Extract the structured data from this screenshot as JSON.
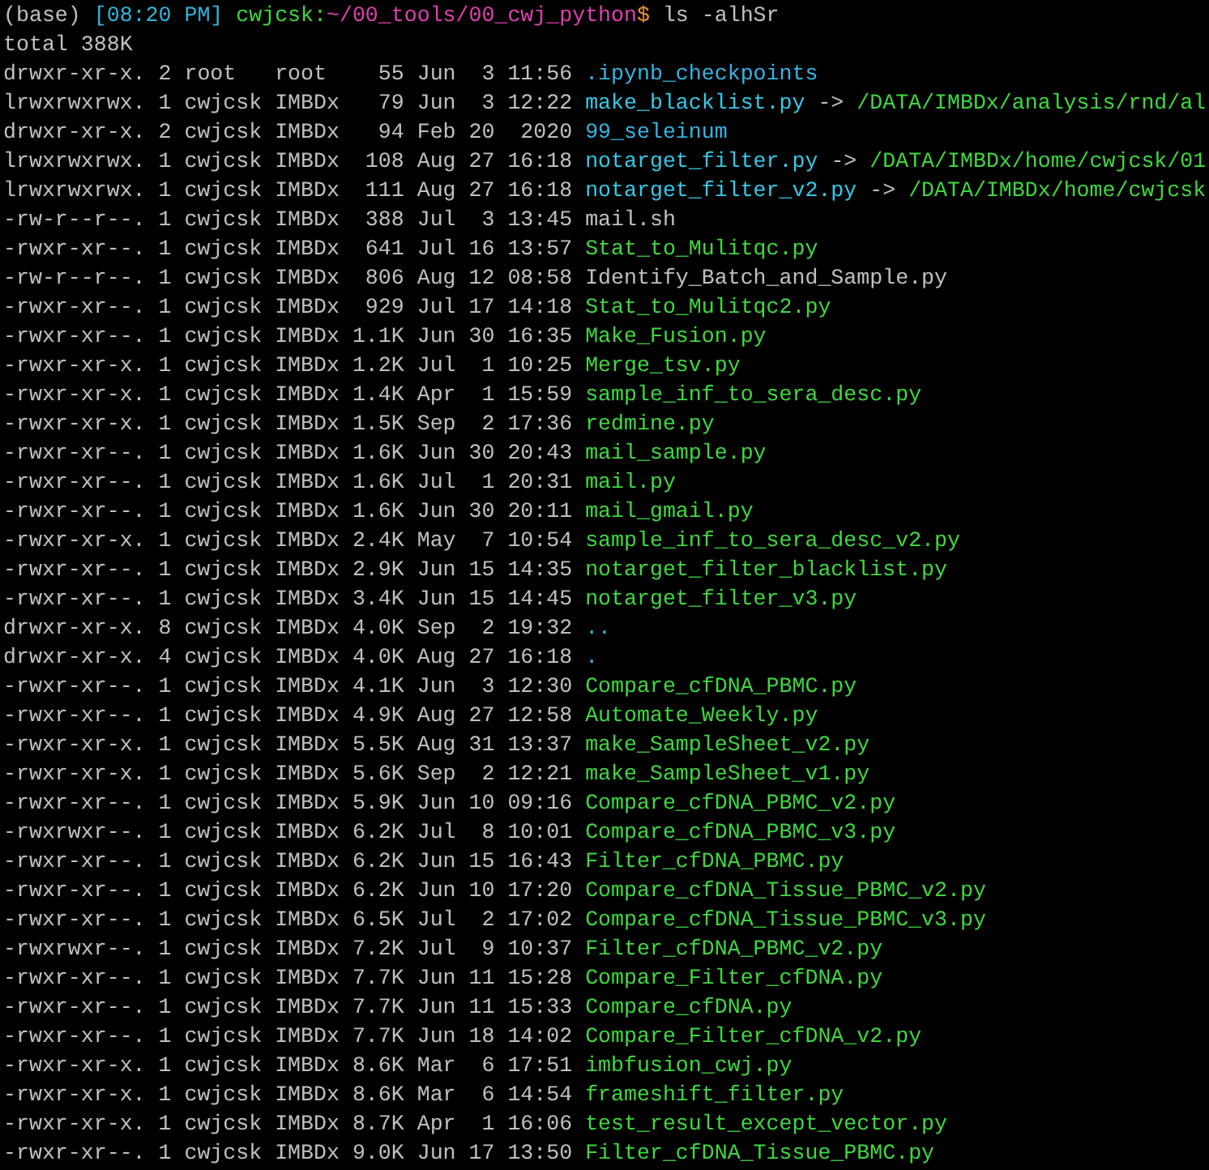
{
  "prompt": {
    "env": "(base)",
    "time": "[08:20 PM]",
    "userhost": "cwjcsk:",
    "path": "~/00_tools/00_cwj_python",
    "symbol": "$",
    "command": "ls -alhSr"
  },
  "total": "total 388K",
  "rows": [
    {
      "meta": "drwxr-xr-x. 2 root   root    55 Jun  3 11:56",
      "name": ".ipynb_checkpoints",
      "kind": "dir"
    },
    {
      "meta": "lrwxrwxrwx. 1 cwjcsk IMBDx   79 Jun  3 12:22",
      "name": "make_blacklist.py",
      "kind": "link",
      "arrow": "->",
      "target": "/DATA/IMBDx/analysis/rnd/al"
    },
    {
      "meta": "drwxr-xr-x. 2 cwjcsk IMBDx   94 Feb 20  2020",
      "name": "99_seleinum",
      "kind": "dir"
    },
    {
      "meta": "lrwxrwxrwx. 1 cwjcsk IMBDx  108 Aug 27 16:18",
      "name": "notarget_filter.py",
      "kind": "link",
      "arrow": "->",
      "target": "/DATA/IMBDx/home/cwjcsk/01"
    },
    {
      "meta": "lrwxrwxrwx. 1 cwjcsk IMBDx  111 Aug 27 16:18",
      "name": "notarget_filter_v2.py",
      "kind": "link",
      "arrow": "->",
      "target": "/DATA/IMBDx/home/cwjcsk"
    },
    {
      "meta": "-rw-r--r--. 1 cwjcsk IMBDx  388 Jul  3 13:45",
      "name": "mail.sh",
      "kind": "file"
    },
    {
      "meta": "-rwxr-xr--. 1 cwjcsk IMBDx  641 Jul 16 13:57",
      "name": "Stat_to_Mulitqc.py",
      "kind": "exec"
    },
    {
      "meta": "-rw-r--r--. 1 cwjcsk IMBDx  806 Aug 12 08:58",
      "name": "Identify_Batch_and_Sample.py",
      "kind": "file"
    },
    {
      "meta": "-rwxr-xr--. 1 cwjcsk IMBDx  929 Jul 17 14:18",
      "name": "Stat_to_Mulitqc2.py",
      "kind": "exec"
    },
    {
      "meta": "-rwxr-xr--. 1 cwjcsk IMBDx 1.1K Jun 30 16:35",
      "name": "Make_Fusion.py",
      "kind": "exec"
    },
    {
      "meta": "-rwxr-xr-x. 1 cwjcsk IMBDx 1.2K Jul  1 10:25",
      "name": "Merge_tsv.py",
      "kind": "exec"
    },
    {
      "meta": "-rwxr-xr-x. 1 cwjcsk IMBDx 1.4K Apr  1 15:59",
      "name": "sample_inf_to_sera_desc.py",
      "kind": "exec"
    },
    {
      "meta": "-rwxr-xr-x. 1 cwjcsk IMBDx 1.5K Sep  2 17:36",
      "name": "redmine.py",
      "kind": "exec"
    },
    {
      "meta": "-rwxr-xr--. 1 cwjcsk IMBDx 1.6K Jun 30 20:43",
      "name": "mail_sample.py",
      "kind": "exec"
    },
    {
      "meta": "-rwxr-xr--. 1 cwjcsk IMBDx 1.6K Jul  1 20:31",
      "name": "mail.py",
      "kind": "exec"
    },
    {
      "meta": "-rwxr-xr--. 1 cwjcsk IMBDx 1.6K Jun 30 20:11",
      "name": "mail_gmail.py",
      "kind": "exec"
    },
    {
      "meta": "-rwxr-xr-x. 1 cwjcsk IMBDx 2.4K May  7 10:54",
      "name": "sample_inf_to_sera_desc_v2.py",
      "kind": "exec"
    },
    {
      "meta": "-rwxr-xr--. 1 cwjcsk IMBDx 2.9K Jun 15 14:35",
      "name": "notarget_filter_blacklist.py",
      "kind": "exec"
    },
    {
      "meta": "-rwxr-xr--. 1 cwjcsk IMBDx 3.4K Jun 15 14:45",
      "name": "notarget_filter_v3.py",
      "kind": "exec"
    },
    {
      "meta": "drwxr-xr-x. 8 cwjcsk IMBDx 4.0K Sep  2 19:32",
      "name": "..",
      "kind": "dir"
    },
    {
      "meta": "drwxr-xr-x. 4 cwjcsk IMBDx 4.0K Aug 27 16:18",
      "name": ".",
      "kind": "dir"
    },
    {
      "meta": "-rwxr-xr--. 1 cwjcsk IMBDx 4.1K Jun  3 12:30",
      "name": "Compare_cfDNA_PBMC.py",
      "kind": "exec"
    },
    {
      "meta": "-rwxr-xr--. 1 cwjcsk IMBDx 4.9K Aug 27 12:58",
      "name": "Automate_Weekly.py",
      "kind": "exec"
    },
    {
      "meta": "-rwxr-xr-x. 1 cwjcsk IMBDx 5.5K Aug 31 13:37",
      "name": "make_SampleSheet_v2.py",
      "kind": "exec"
    },
    {
      "meta": "-rwxr-xr-x. 1 cwjcsk IMBDx 5.6K Sep  2 12:21",
      "name": "make_SampleSheet_v1.py",
      "kind": "exec"
    },
    {
      "meta": "-rwxr-xr--. 1 cwjcsk IMBDx 5.9K Jun 10 09:16",
      "name": "Compare_cfDNA_PBMC_v2.py",
      "kind": "exec"
    },
    {
      "meta": "-rwxrwxr--. 1 cwjcsk IMBDx 6.2K Jul  8 10:01",
      "name": "Compare_cfDNA_PBMC_v3.py",
      "kind": "exec"
    },
    {
      "meta": "-rwxr-xr--. 1 cwjcsk IMBDx 6.2K Jun 15 16:43",
      "name": "Filter_cfDNA_PBMC.py",
      "kind": "exec"
    },
    {
      "meta": "-rwxr-xr--. 1 cwjcsk IMBDx 6.2K Jun 10 17:20",
      "name": "Compare_cfDNA_Tissue_PBMC_v2.py",
      "kind": "exec"
    },
    {
      "meta": "-rwxr-xr--. 1 cwjcsk IMBDx 6.5K Jul  2 17:02",
      "name": "Compare_cfDNA_Tissue_PBMC_v3.py",
      "kind": "exec"
    },
    {
      "meta": "-rwxrwxr--. 1 cwjcsk IMBDx 7.2K Jul  9 10:37",
      "name": "Filter_cfDNA_PBMC_v2.py",
      "kind": "exec"
    },
    {
      "meta": "-rwxr-xr--. 1 cwjcsk IMBDx 7.7K Jun 11 15:28",
      "name": "Compare_Filter_cfDNA.py",
      "kind": "exec"
    },
    {
      "meta": "-rwxr-xr--. 1 cwjcsk IMBDx 7.7K Jun 11 15:33",
      "name": "Compare_cfDNA.py",
      "kind": "exec"
    },
    {
      "meta": "-rwxr-xr--. 1 cwjcsk IMBDx 7.7K Jun 18 14:02",
      "name": "Compare_Filter_cfDNA_v2.py",
      "kind": "exec"
    },
    {
      "meta": "-rwxr-xr-x. 1 cwjcsk IMBDx 8.6K Mar  6 17:51",
      "name": "imbfusion_cwj.py",
      "kind": "exec"
    },
    {
      "meta": "-rwxr-xr-x. 1 cwjcsk IMBDx 8.6K Mar  6 14:54",
      "name": "frameshift_filter.py",
      "kind": "exec"
    },
    {
      "meta": "-rwxr-xr-x. 1 cwjcsk IMBDx 8.7K Apr  1 16:06",
      "name": "test_result_except_vector.py",
      "kind": "exec"
    },
    {
      "meta": "-rwxr-xr--. 1 cwjcsk IMBDx 9.0K Jun 17 13:50",
      "name": "Filter_cfDNA_Tissue_PBMC.py",
      "kind": "exec"
    }
  ]
}
